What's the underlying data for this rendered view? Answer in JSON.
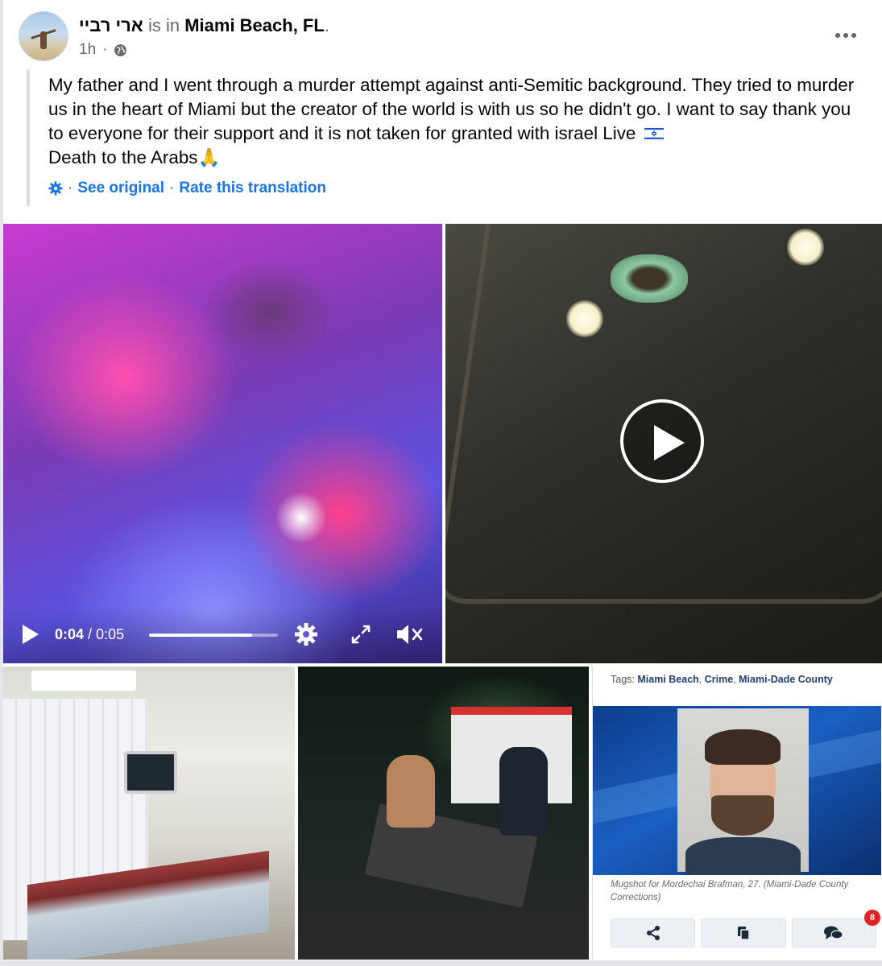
{
  "post": {
    "author": "ארי רביי",
    "connector": "is in",
    "place": "Miami Beach, FL",
    "period": ".",
    "time": "1h",
    "privacy_icon": "globe-icon",
    "more_icon": "more-options-icon",
    "text": "My father and I went through a murder attempt against anti-Semitic background. They tried to murder us in the heart of Miami but the creator of the world is with us so he didn't go. I want to say thank you to everyone for their support and it is not taken for granted with israel Live",
    "text_after_flag": "Death to the Arabs🙏",
    "translation": {
      "icon": "gear-icon",
      "separator": "·",
      "see_original": "See original",
      "rate": "Rate this translation"
    }
  },
  "media": {
    "video_player": {
      "current_time": "0:04",
      "separator": " / ",
      "duration": "0:05",
      "progress": 0.8,
      "icons": [
        "play-icon",
        "settings-gear-icon",
        "fullscreen-icon",
        "mute-icon"
      ]
    },
    "video_tile_2": {
      "overlay_icon": "play-circle-icon"
    },
    "news_card": {
      "tags_label": "Tags:",
      "tags": [
        "Miami Beach",
        "Crime",
        "Miami-Dade County"
      ],
      "tag_separator": ", ",
      "caption": "Mugshot for Mordechai Brafman, 27. (Miami-Dade County Corrections)",
      "actions": [
        {
          "icon": "share-icon"
        },
        {
          "icon": "copy-icon"
        },
        {
          "icon": "comments-icon",
          "badge": "8"
        }
      ]
    }
  },
  "colors": {
    "link_blue": "#1b74e4",
    "secondary_text": "#65676b",
    "badge_red": "#e02424"
  }
}
